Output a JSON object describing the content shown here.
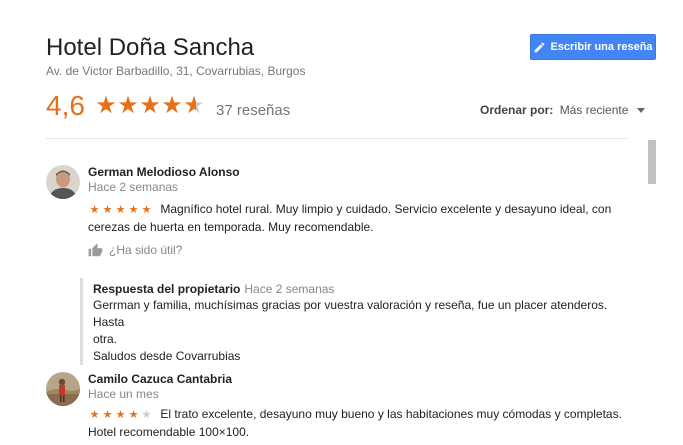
{
  "header": {
    "title": "Hotel Doña Sancha",
    "address": "Av. de Victor Barbadillo, 31, Covarrubias, Burgos",
    "write_review_label": "Escribir una reseña",
    "rating": "4,6",
    "rating_value": 4.6,
    "review_count": "37 reseñas",
    "sort_label": "Ordenar por:",
    "sort_value": "Más reciente"
  },
  "reviews": [
    {
      "author": "German Melodioso Alonso",
      "time": "Hace 2 semanas",
      "stars": 5,
      "text_line1": "Magnífico hotel rural. Muy limpio y cuidado. Servicio excelente y desayuno ideal, con",
      "text_line2": "cerezas de huerta en temporada. Muy recomendable.",
      "helpful": "¿Ha sido útil?",
      "owner_reply": {
        "title": "Respuesta del propietario",
        "time": "Hace 2 semanas",
        "line1": "Gerrman y familia, muchísimas gracias por vuestra valoración y reseña, fue un placer atenderos. Hasta",
        "line2": "otra.",
        "line3": "Saludos desde Covarrubias"
      }
    },
    {
      "author": "Camilo Cazuca Cantabria",
      "time": "Hace un mes",
      "stars": 4,
      "text_line1": "El trato excelente, desayuno muy bueno y las habitaciones muy cómodas y completas.",
      "text_line2": "Hotel recomendable 100×100."
    }
  ],
  "colors": {
    "accent": "#e7711b",
    "button": "#4285f4"
  },
  "icons": [
    "pencil-icon",
    "star-icon",
    "thumbs-up-icon",
    "caret-down-icon"
  ]
}
